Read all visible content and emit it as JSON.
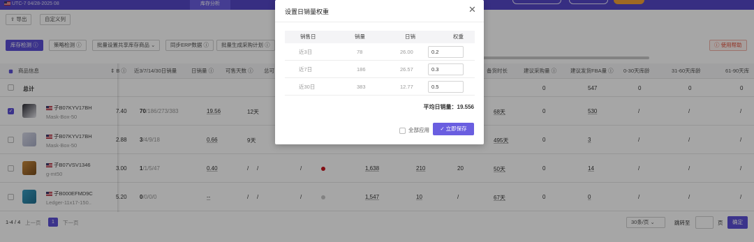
{
  "topbar": {
    "env_label": "UTC-7 04/28-2025 08",
    "active_tab": "库存分析"
  },
  "toolbar": {
    "export_label": "导出",
    "custom_columns_label": "自定义列"
  },
  "actions": {
    "inventory_check": "库存检测 ⓘ",
    "strategy_check": "策略检测 ⓘ",
    "batch_shared": "批量设置共享库存商品 ⌄",
    "sync_erp": "同步ERP数据 ⓘ",
    "batch_purchase": "批量生成采购计划 ⓘ",
    "help": "ⓘ 使用帮助"
  },
  "table": {
    "headers": {
      "product": "商品信息",
      "sort_marker": "⇕ B ⓘ",
      "sales_3714": "近3/7/14/30日销量",
      "daily_sales": "日销量 ⓘ",
      "days_available": "可售天数 ⓘ",
      "partial": "总可",
      "backup_days": "备货时长",
      "suggest_purchase": "建议采购量 ⓘ",
      "suggest_fba": "建议发货FBA量 ⓘ",
      "age_0_30": "0-30天库龄",
      "age_31_60": "31-60天库龄",
      "age_61_90": "61-90天库"
    },
    "total_label": "总计",
    "totals": {
      "suggest_purchase": "0",
      "suggest_fba": "547",
      "age_0_30": "0",
      "age_31_60": "0",
      "age_61_90": "0"
    },
    "rows": [
      {
        "asin": "子B07KYV17BH",
        "sku": "Mask-Box-50",
        "b": "7.40",
        "sales_bold": "70",
        "sales_rest": "/186/273/383",
        "daily": "19.56",
        "days": "12天",
        "col_a": "",
        "col_b": "",
        "m1": "",
        "m2": "",
        "m3": "",
        "backup": "68天",
        "purchase": "0",
        "fba": "530",
        "a1": "/",
        "a2": "/",
        "a3": "/",
        "checked": true,
        "dot": ""
      },
      {
        "asin": "子B07KYV17BH",
        "sku": "Mask-Box-50",
        "b": "2.88",
        "sales_bold": "3",
        "sales_rest": "/4/9/18",
        "daily": "0.66",
        "days": "9天",
        "col_a": "",
        "col_b": "",
        "m1": "",
        "m2": "",
        "m3": "",
        "backup": "495天",
        "purchase": "0",
        "fba": "3",
        "a1": "/",
        "a2": "/",
        "a3": "/",
        "checked": false,
        "dot": ""
      },
      {
        "asin": "子B07VSV1346",
        "sku": "g-mt50",
        "b": "3.00",
        "sales_bold": "1",
        "sales_rest": "/1/5/47",
        "daily": "0.40",
        "days": "/",
        "col_a": "/",
        "col_b": "/",
        "m1": "1,638",
        "m2": "210",
        "m3": "20",
        "backup": "50天",
        "purchase": "0",
        "fba": "14",
        "a1": "/",
        "a2": "/",
        "a3": "/",
        "checked": false,
        "dot": "#c8141e"
      },
      {
        "asin": "子B000EFMD9C",
        "sku": "Ledger-11x17-150..",
        "b": "5.20",
        "sales_bold": "0",
        "sales_rest": "/0/0/0",
        "daily": "--",
        "days": "/",
        "col_a": "/",
        "col_b": "/",
        "m1": "1,547",
        "m2": "10",
        "m3": "/",
        "backup": "67天",
        "purchase": "0",
        "fba": "0",
        "a1": "/",
        "a2": "/",
        "a3": "/",
        "checked": false,
        "dot": "#c8c8c8"
      }
    ]
  },
  "pagination": {
    "range": "1-4 / 4",
    "prev": "上一页",
    "next": "下一页",
    "current": "1",
    "per_page": "30条/页 ⌄",
    "goto": "跳转至",
    "page_unit": "页",
    "confirm": "确定"
  },
  "modal": {
    "title": "设置日销量权重",
    "close": "✕",
    "headers": {
      "period": "销售日",
      "qty": "销量",
      "daily": "日销",
      "weight": "权重"
    },
    "rows": [
      {
        "period": "近3日",
        "qty": "78",
        "daily": "26.00",
        "weight": "0.2"
      },
      {
        "period": "近7日",
        "qty": "186",
        "daily": "26.57",
        "weight": "0.3"
      },
      {
        "period": "近30日",
        "qty": "383",
        "daily": "12.77",
        "weight": "0.5"
      }
    ],
    "avg_label": "平均日销量：",
    "avg_value": "19.556",
    "apply_all": "全部应用",
    "save": "✓ 立即保存"
  }
}
